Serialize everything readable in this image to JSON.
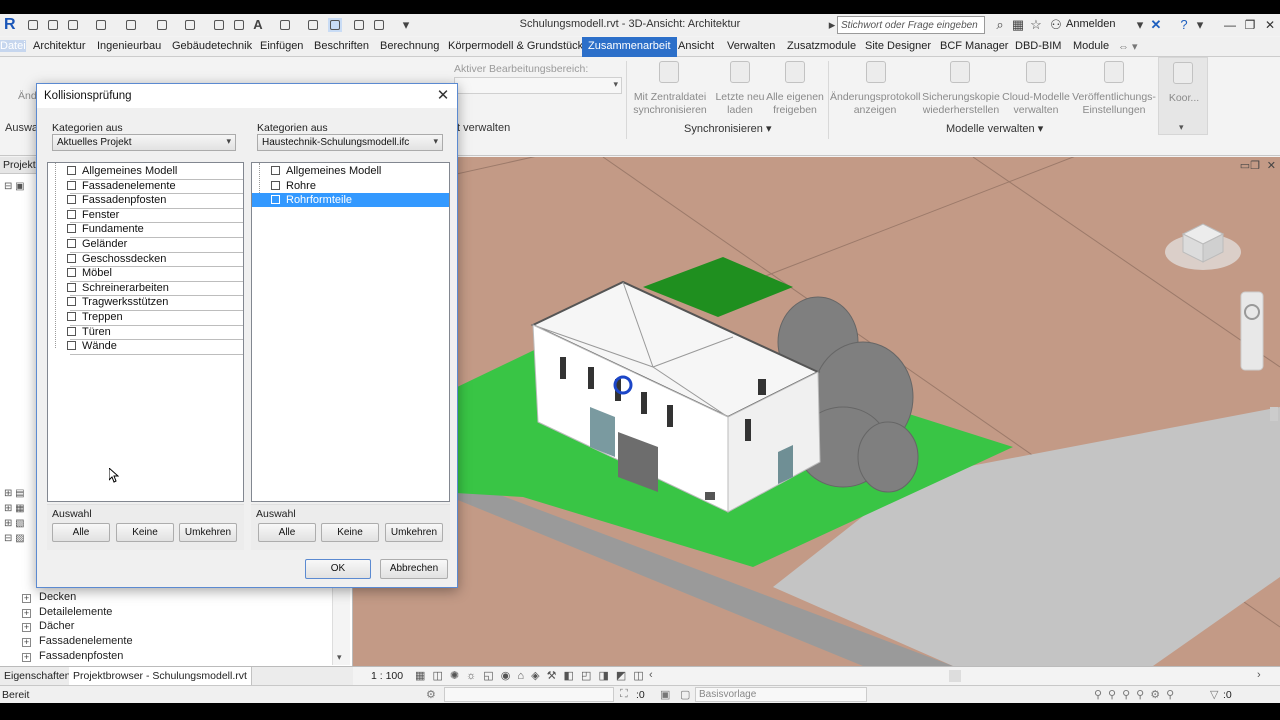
{
  "app": {
    "title": "Schulungsmodell.rvt - 3D-Ansicht: Architektur",
    "logo": "R",
    "search_placeholder": "Stichwort oder Frage eingeben",
    "signin": "Anmelden"
  },
  "ribbon": {
    "tabs": [
      "Datei",
      "Architektur",
      "Ingenieurbau",
      "Gebäudetechnik",
      "Einfügen",
      "Beschriften",
      "Berechnung",
      "Körpermodell & Grundstück",
      "Zusammenarbeit",
      "Ansicht",
      "Verwalten",
      "Zusatzmodule",
      "Site Designer",
      "BCF Manager",
      "DBD-BIM",
      "Module"
    ],
    "active_tab": "Zusammenarbeit",
    "workset_label": "Aktiver Bearbeitungsbereich:",
    "buttons": {
      "sync": "Mit Zentraldatei synchronisieren",
      "reload": "Letzte neu laden",
      "release": "Alle eigenen freigeben",
      "changelog": "Änderungsprotokoll anzeigen",
      "restore": "Sicherungskopie wiederherstellen",
      "cloud": "Cloud-Modelle verwalten",
      "publish": "Veröffentlichungs-Einstellungen",
      "coord": "Koor..."
    },
    "partial_left": "Änd",
    "partial_auswahl": "Auswah",
    "panel_manage_partial": "t verwalten",
    "panels": {
      "sync": "Synchronisieren",
      "models": "Modelle verwalten"
    }
  },
  "dialog": {
    "title": "Kollisionsprüfung",
    "left": {
      "label": "Kategorien aus",
      "source": "Aktuelles Projekt",
      "items": [
        "Allgemeines Modell",
        "Fassadenelemente",
        "Fassadenpfosten",
        "Fenster",
        "Fundamente",
        "Geländer",
        "Geschossdecken",
        "Möbel",
        "Schreinerarbeiten",
        "Tragwerksstützen",
        "Treppen",
        "Türen",
        "Wände"
      ],
      "selection_label": "Auswahl"
    },
    "right": {
      "label": "Kategorien aus",
      "source": "Haustechnik-Schulungsmodell.ifc",
      "items": [
        "Allgemeines Modell",
        "Rohre",
        "Rohrformteile"
      ],
      "selected_index": 2,
      "selection_label": "Auswahl"
    },
    "btn_all": "Alle",
    "btn_none": "Keine",
    "btn_invert": "Umkehren",
    "ok": "OK",
    "cancel": "Abbrechen"
  },
  "project_browser": {
    "header": "Projektb",
    "items": [
      "Decken",
      "Detailelemente",
      "Dächer",
      "Fassadenelemente",
      "Fassadenpfosten"
    ]
  },
  "bottom_tabs": [
    "Eigenschaften",
    "Projektbrowser - Schulungsmodell.rvt"
  ],
  "viewbar": {
    "scale": "1 : 100"
  },
  "statusbar": {
    "text": "Bereit",
    "selection_count": ":0",
    "view_template": "Basisvorlage",
    "filter_count": ":0"
  },
  "colors": {
    "accent": "#2c6fc9",
    "selection": "#3399ff",
    "ground": "#c39a86",
    "lawn": "#39c545"
  }
}
